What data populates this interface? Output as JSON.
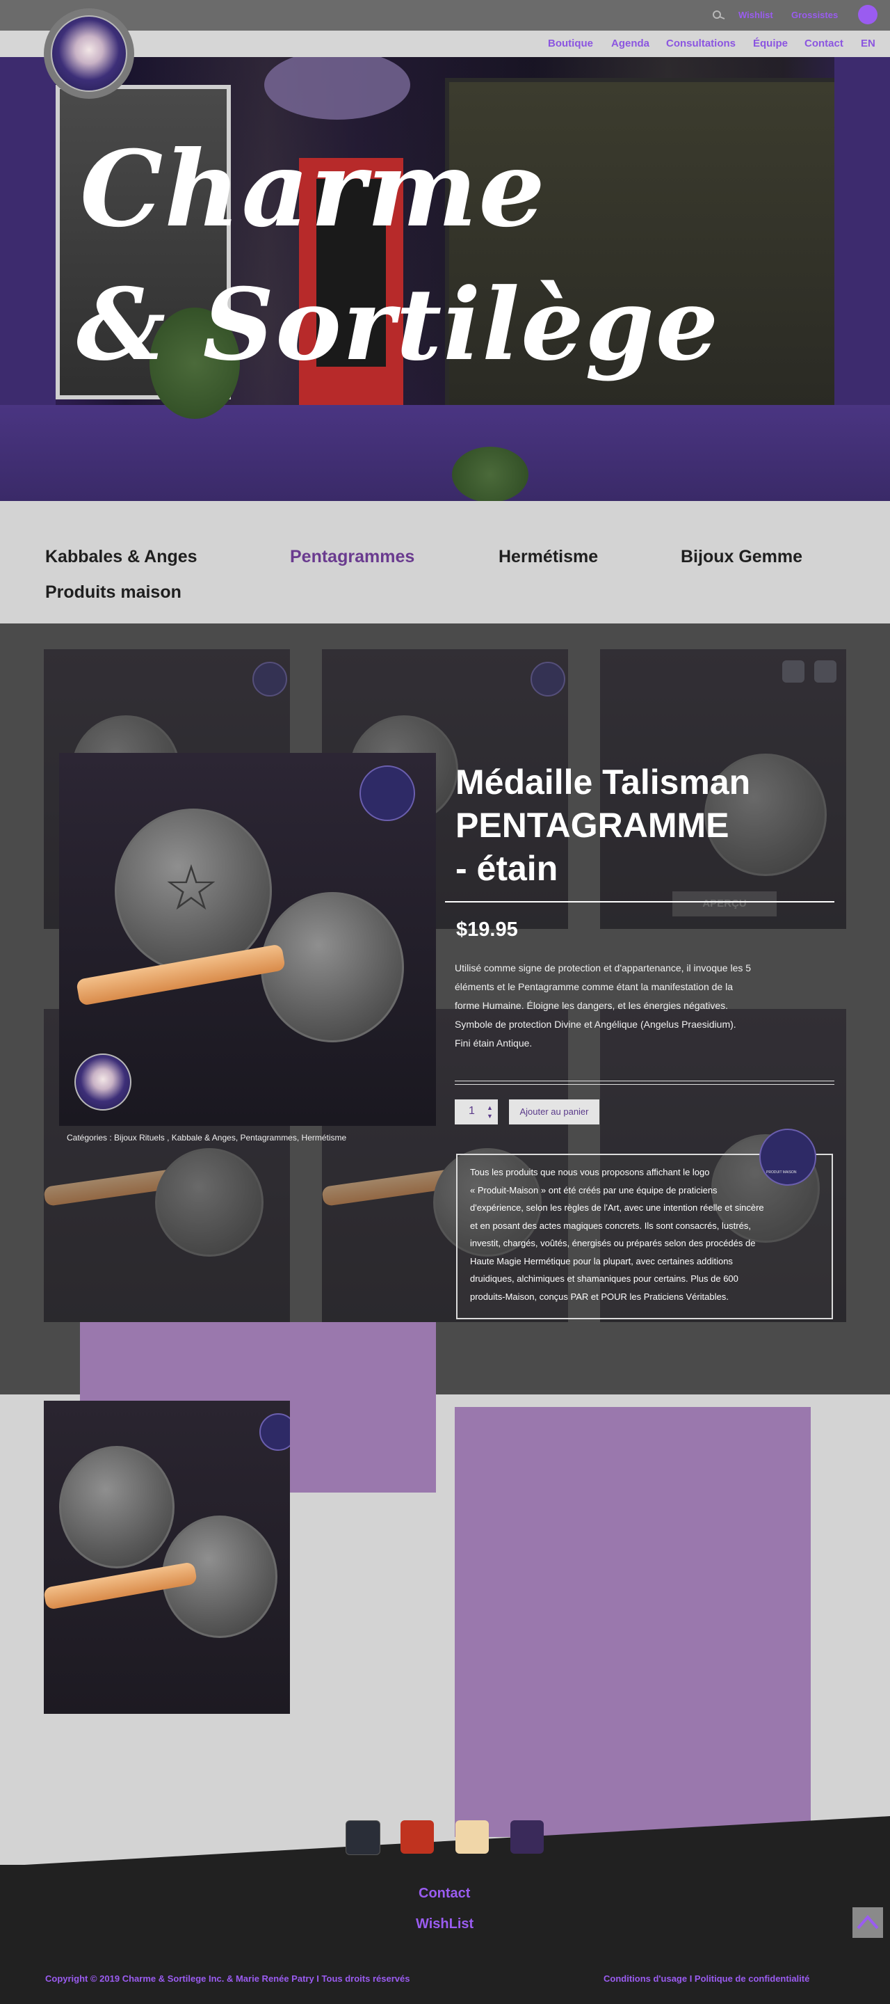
{
  "top_links": {
    "wishlist": "Wishlist",
    "grossistes": "Grossistes"
  },
  "nav": {
    "items": [
      "Boutique",
      "Agenda",
      "Consultations",
      "Équipe",
      "Contact",
      "EN"
    ]
  },
  "hero": {
    "line1": "Charme",
    "line2": "& Sortilège"
  },
  "categories": [
    "Kabbales & Anges",
    "Pentagrammes",
    "Hermétisme",
    "Bijoux Gemme",
    "Produits maison"
  ],
  "active_category": "Pentagrammes",
  "product": {
    "title_line1": "Médaille Talisman",
    "title_line2": "PENTAGRAMME",
    "title_line3": "- étain",
    "price": "$19.95",
    "description": [
      "Utilisé comme signe de protection et d'appartenance, il invoque les 5",
      "éléments et le Pentagramme comme étant la manifestation de la",
      "forme Humaine. Éloigne les dangers, et les énergies négatives.",
      "Symbole de protection Divine et Angélique (Angelus Praesidium).",
      "Fini étain Antique."
    ],
    "quantity": "1",
    "add_to_cart": "Ajouter au panier",
    "categories_label": "Catégories :",
    "categories_value": "Bijoux Rituels , Kabbale & Anges, Pentagrammes, Hermétisme",
    "apercu": "APERÇU",
    "badge_text": "PRODUIT MAISON",
    "note": [
      "Tous les produits que nous vous proposons affichant le logo",
      "« Produit-Maison » ont été créés par une équipe de praticiens",
      "d'expérience, selon les règles de l'Art, avec une intention réelle et sincère",
      "et en posant des actes magiques concrets. Ils sont consacrés, lustrés,",
      "investit, chargés, voûtés, énergisés ou préparés selon des procédés de",
      "Haute Magie Hermétique pour la plupart, avec certaines additions",
      "druidiques, alchimiques et shamaniques pour certains. Plus de 600",
      "produits-Maison, conçus PAR et POUR les Praticiens Véritables."
    ]
  },
  "footer": {
    "contact": "Contact",
    "wishlist": "WishList",
    "copyright": "Copyright © 2019 Charme & Sortilege Inc. & Marie Renée Patry I Tous droits réservés",
    "legal": "Conditions d'usage I Politique de confidentialité"
  },
  "colors": {
    "accent": "#9a5cf0",
    "purple_block": "#9a78ad",
    "grid_bg": "#585858",
    "footer_bg": "#212121"
  },
  "icons": {
    "search": "search-icon",
    "cart": "cart-dot-icon",
    "scroll_top": "chevron-up-icon"
  }
}
